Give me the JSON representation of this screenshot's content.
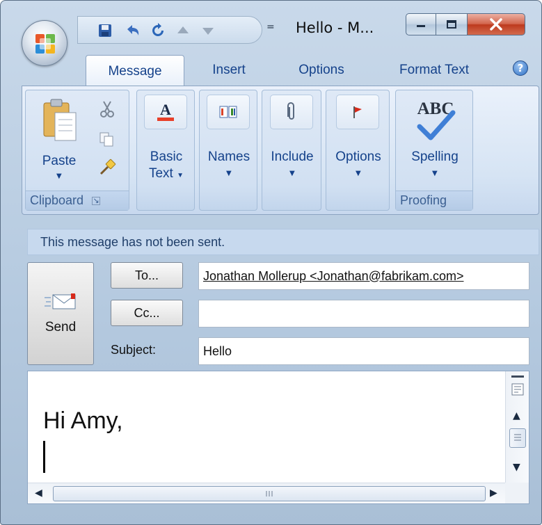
{
  "window": {
    "title": "Hello - M...",
    "qat_dropdown_glyph": "="
  },
  "tabs": [
    {
      "label": "Message",
      "active": true
    },
    {
      "label": "Insert"
    },
    {
      "label": "Options"
    },
    {
      "label": "Format Text"
    }
  ],
  "ribbon": {
    "clipboard": {
      "label": "Clipboard",
      "paste_label": "Paste"
    },
    "basic_text": {
      "line1": "Basic",
      "line2": "Text"
    },
    "names": {
      "label": "Names"
    },
    "include": {
      "label": "Include"
    },
    "options": {
      "label": "Options"
    },
    "proofing": {
      "label": "Proofing",
      "spelling_label": "Spelling",
      "abc": "ABC"
    }
  },
  "info_bar": {
    "text": "This message has not been sent."
  },
  "header": {
    "send_label": "Send",
    "to_button": "To...",
    "cc_button": "Cc...",
    "subject_label": "Subject:",
    "to_value": "Jonathan Mollerup <Jonathan@fabrikam.com>",
    "cc_value": "",
    "subject_value": "Hello"
  },
  "body": {
    "text": "Hi Amy,"
  },
  "colors": {
    "accent_text": "#15428b",
    "ribbon_bg": "#d6e4f4",
    "close_button": "#c6482a",
    "info_bar": "#c7d9ee"
  }
}
